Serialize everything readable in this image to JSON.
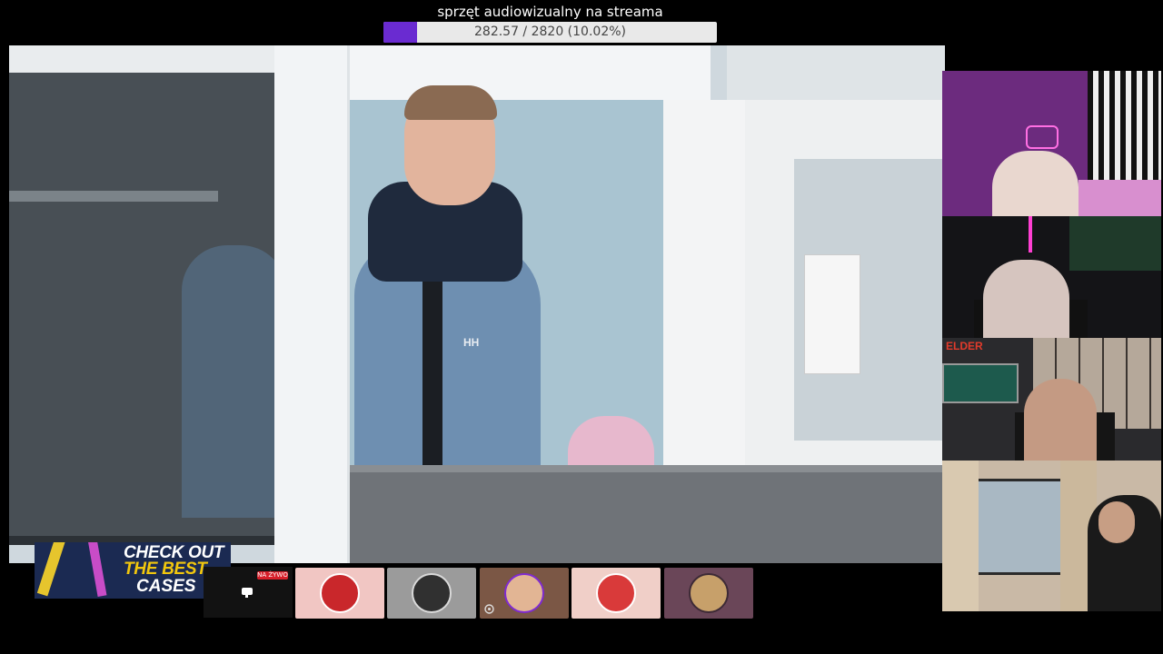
{
  "donation_goal": {
    "title": "sprzęt audiowizualny na streama",
    "progress_text": "282.57 / 2820 (10.02%)",
    "current": 282.57,
    "target": 2820,
    "percent": 10.02,
    "fill_color": "#6a2bd1"
  },
  "main_video": {
    "jacket_logo": "HH"
  },
  "webcams": {
    "cam3_overlay": "ELDER"
  },
  "ad_banner": {
    "line1": "CHECK OUT",
    "line2": "THE BEST",
    "line3": "CASES",
    "accent_color": "#f2c70d"
  },
  "stream_bar": {
    "live_badge": "NA ŻYWO",
    "live_color": "#d61f2a",
    "icons": {
      "chat": "chat-bubble-icon",
      "mini": "settings-icon"
    },
    "thumbnails": [
      {
        "name": "channel-1"
      },
      {
        "name": "channel-2"
      },
      {
        "name": "channel-3"
      },
      {
        "name": "channel-4"
      },
      {
        "name": "channel-5"
      }
    ]
  }
}
